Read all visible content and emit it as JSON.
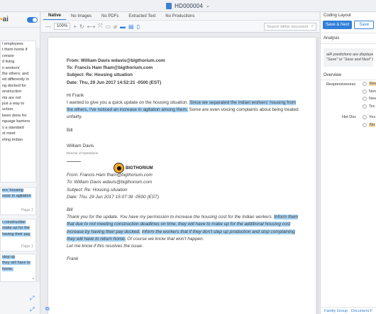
{
  "window": {
    "title": "HD000004"
  },
  "left_panel": {
    "logo_text": "ai",
    "cards": [
      {
        "lines": [
          {
            "t": "l employees",
            "h": false
          },
          {
            "t": "t them home if",
            "h": false
          },
          {
            "t": "crease",
            "h": false
          },
          {
            "t": "d living",
            "h": false
          },
          {
            "t": "n workers'",
            "h": false
          },
          {
            "t": "the others; and",
            "h": false
          },
          {
            "t": "ed differently in",
            "h": false
          },
          {
            "t": "ng docked for",
            "h": false
          },
          {
            "t": "onstruction",
            "h": false
          },
          {
            "t": "",
            "h": false
          },
          {
            "t": "nts are not",
            "h": false
          },
          {
            "t": "just a way to",
            "h": false
          },
          {
            "t": "uction.",
            "h": false
          },
          {
            "t": "been done for",
            "h": false
          },
          {
            "t": "nguage barriers",
            "h": false
          },
          {
            "t": "",
            "h": false
          },
          {
            "t": "s a standard",
            "h": false
          },
          {
            "t": "ot meet",
            "h": false
          },
          {
            "t": "eting Indian",
            "h": false
          }
        ]
      },
      {
        "lines": [
          {
            "t": "ers' housing",
            "h": true
          },
          {
            "t": "ease in agitation",
            "h": true
          }
        ],
        "page": "Page 1"
      },
      {
        "lines": [
          {
            "t": "t construction",
            "h": true
          },
          {
            "t": "make up for the",
            "h": true
          },
          {
            "t": "having their pay",
            "h": true
          }
        ],
        "page": "Page 1"
      },
      {
        "lines": [
          {
            "t": "step up",
            "h": true
          },
          {
            "t": "they will have to",
            "h": true
          },
          {
            "t": "home.",
            "h": true
          }
        ]
      }
    ]
  },
  "tabs": [
    {
      "label": "Native",
      "active": true
    },
    {
      "label": "No Images",
      "active": false
    },
    {
      "label": "No PDFs",
      "active": false
    },
    {
      "label": "Extracted Text",
      "active": false
    },
    {
      "label": "No Productions",
      "active": false
    }
  ],
  "toolbar": {
    "zoom": "100%",
    "search_placeholder": "Search within document"
  },
  "email1": {
    "from": "From: William Davis wdavis@bigthorium.com",
    "to": "To: Francis Ham fham@bigthorium.com",
    "subject": "Subject: Re: Housing situation",
    "date": "Date: Thu, 29 Jun 2017 14:52:21 -0500 (EST)",
    "greeting": "Hi Frank",
    "body": [
      {
        "t": "I wanted to give you a quick update on the housing situation. ",
        "h": false
      },
      {
        "t": "Since we separated the Indian workers' housing from the others, I've noticed an increase in agitation among them.",
        "h": true
      },
      {
        "t": " Some are even voicing complaints about being treated unfairly.",
        "h": false
      }
    ],
    "closing": "Bill",
    "sig_name": "William Davis",
    "sig_title": "Director of Operations",
    "brand": "BIGTHORIUM"
  },
  "email2": {
    "from": "From: Francis Ham fham@bigthorium.com",
    "to": "To: William Davis wdavis@bigthorium.com",
    "subject": "Subject: Re: Housing situation",
    "date": "Date: Thu, 29 Jun 2017 15:07:39 -0500 (EST)",
    "greeting": "Bill",
    "body": [
      {
        "t": "Thank you for the update. You have my permission to increase the housing cost for the Indian workers. ",
        "h": false
      },
      {
        "t": "Inform them that due to not meeting construction deadlines on time, they will have to make up for the additional housing cost increase by having their pay docked.",
        "h": true
      },
      {
        "t": " ",
        "h": false
      },
      {
        "t": "Inform the workers that if they don't step up production and stop complaining they will have to return home.",
        "h": true
      },
      {
        "t": " Of course we know that won't happen.",
        "h": false
      }
    ],
    "line2": "Let me know if this resolves the issue.",
    "closing": "Frank"
  },
  "right_panel": {
    "header": "Coding Layout",
    "save_next": "Save & Next",
    "save": "Save",
    "analysis": "Analysis",
    "ai_note_1": "aiR predictions are displayed",
    "ai_note_2": "\"Save\" or \"Save and Next\" to",
    "overview": "Overview",
    "responsiveness_label": "Responsiveness",
    "responsiveness_options": [
      "Res",
      "Non",
      "Nee",
      "Tec"
    ],
    "hot_doc_label": "Hot Doc",
    "hot_doc_options": [
      "Yes",
      "No"
    ],
    "footer_family": "Family Group",
    "footer_doc": "Document F"
  },
  "colors": {
    "accent": "#2f7fd9",
    "highlight": "#a9d4f5",
    "ai_highlight": "#f7d9a8"
  }
}
